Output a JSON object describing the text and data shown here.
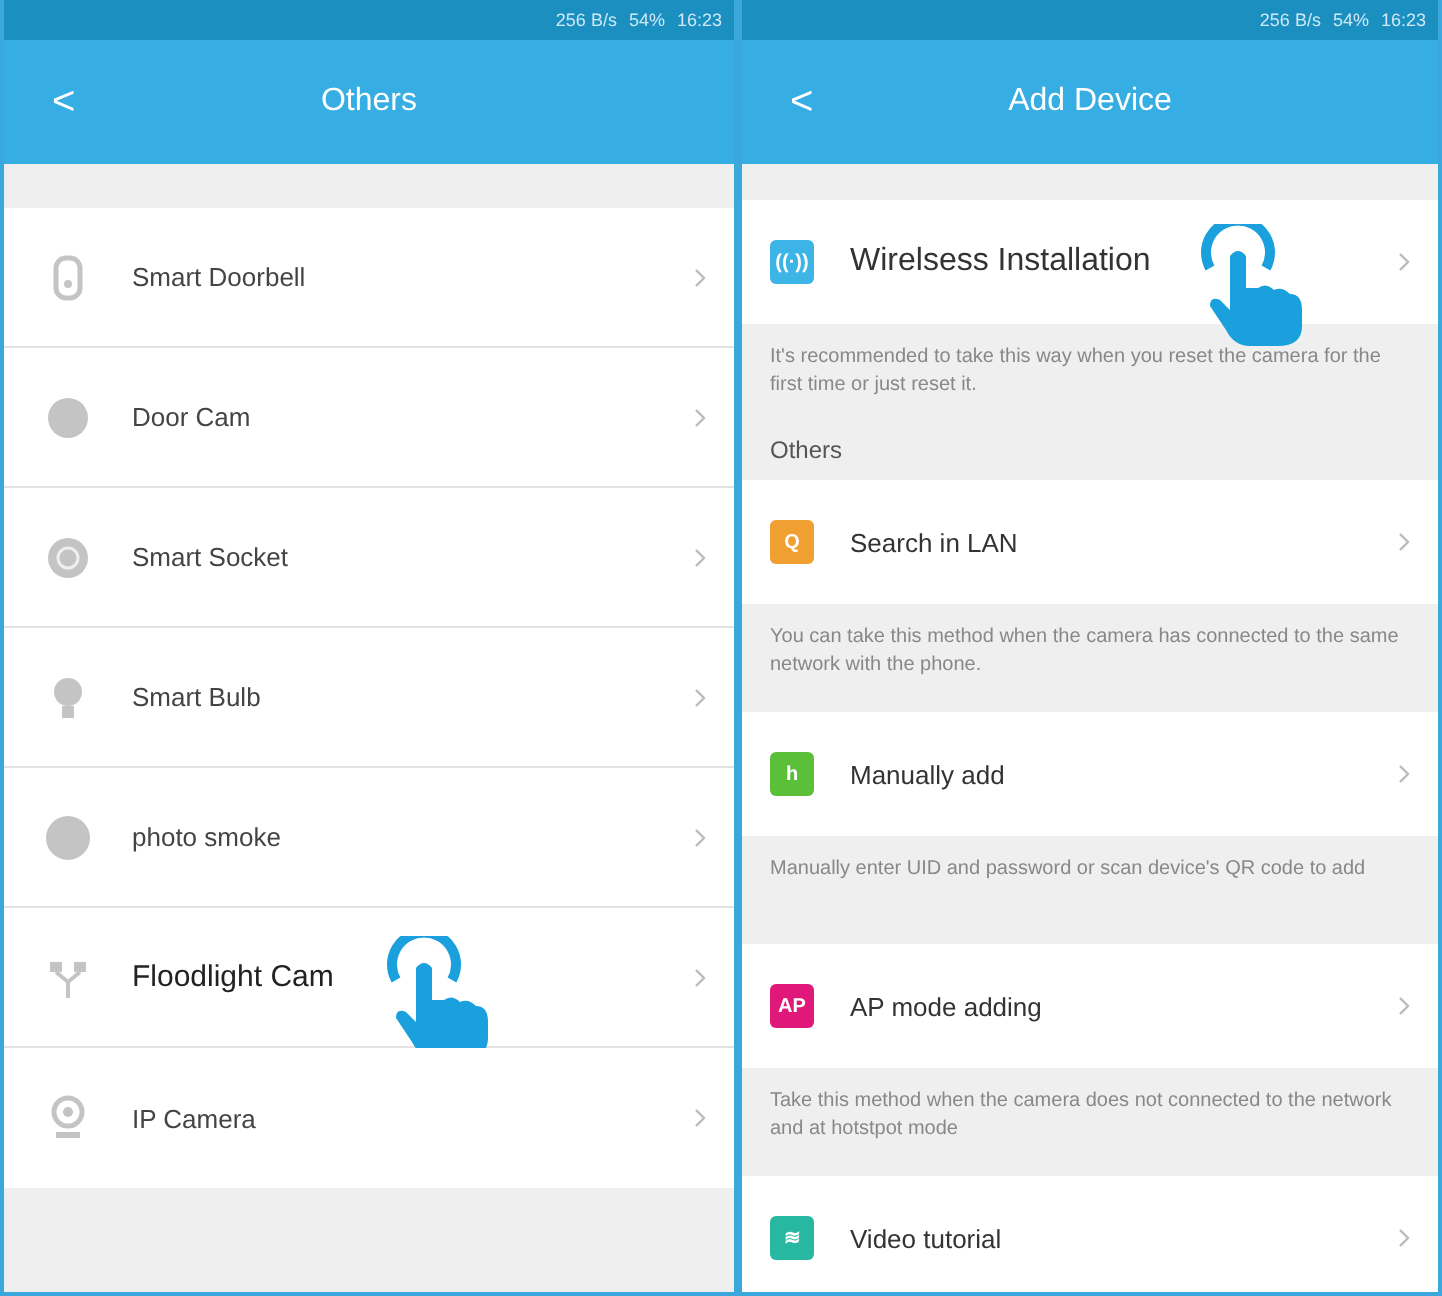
{
  "screens": [
    {
      "status_bar": {
        "speed": "256 B/s",
        "battery": "54%",
        "time": "16:23"
      },
      "header": {
        "back": "<",
        "title": "Others"
      },
      "devices": [
        {
          "label": "Smart Doorbell",
          "kind": "doorbell",
          "selected": false
        },
        {
          "label": "Door Cam",
          "kind": "doorcam",
          "selected": false
        },
        {
          "label": "Smart Socket",
          "kind": "socket",
          "selected": false
        },
        {
          "label": "Smart Bulb",
          "kind": "bulb",
          "selected": false
        },
        {
          "label": "photo smoke",
          "kind": "smoke",
          "selected": false
        },
        {
          "label": "Floodlight Cam",
          "kind": "floodlight",
          "selected": true
        },
        {
          "label": "IP Camera",
          "kind": "ipcam",
          "selected": false
        }
      ]
    },
    {
      "status_bar": {
        "speed": "256 B/s",
        "battery": "54%",
        "time": "16:23"
      },
      "header": {
        "back": "<",
        "title": "Add Device"
      },
      "items": [
        {
          "kind": "option",
          "label": "Wirelsess Installation",
          "icon": "((·))",
          "color": "#3db4e6",
          "tapped": true
        },
        {
          "kind": "description",
          "text": "It's recommended to take this way when you reset the camera for the first time or just reset it."
        },
        {
          "kind": "section",
          "text": "Others"
        },
        {
          "kind": "option",
          "label": "Search in LAN",
          "icon": "Q",
          "color": "#f0a030",
          "tapped": false
        },
        {
          "kind": "description",
          "text": "You can take this method when the camera has connected to the same network with the phone."
        },
        {
          "kind": "option",
          "label": "Manually add",
          "icon": "h",
          "color": "#5cbf3a",
          "tapped": false
        },
        {
          "kind": "description",
          "text": "Manually enter UID and password or scan device's QR code to add"
        },
        {
          "kind": "option",
          "label": "AP mode adding",
          "icon": "AP",
          "color": "#e0187a",
          "tapped": false
        },
        {
          "kind": "description",
          "text": "Take this method when the camera does not connected to the network and at hotstpot mode"
        },
        {
          "kind": "option",
          "label": "Video tutorial",
          "icon": "≋",
          "color": "#26b8a0",
          "tapped": false
        }
      ]
    }
  ]
}
